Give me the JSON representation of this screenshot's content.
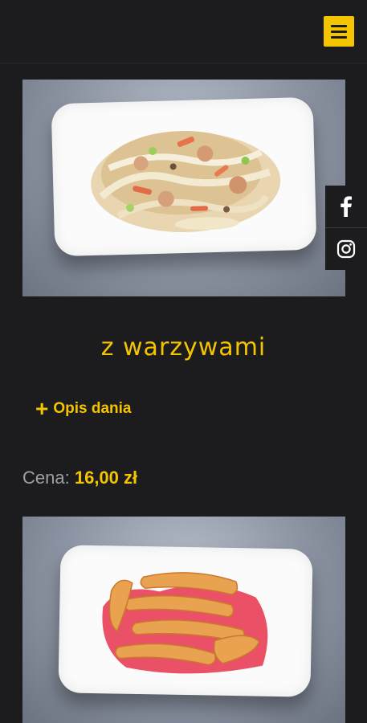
{
  "header": {
    "menu_icon": "hamburger-menu-icon"
  },
  "social": [
    {
      "name": "facebook",
      "icon": "facebook-icon"
    },
    {
      "name": "instagram",
      "icon": "instagram-icon"
    }
  ],
  "dishes": [
    {
      "title": "z  warzywami",
      "description_toggle": "Opis dania",
      "price_label": "Cena:",
      "price_value": "16,00 zł"
    },
    {
      "title": ""
    }
  ],
  "colors": {
    "accent": "#f5c400",
    "background": "#1c1c1e",
    "muted": "#a0a0a4"
  }
}
